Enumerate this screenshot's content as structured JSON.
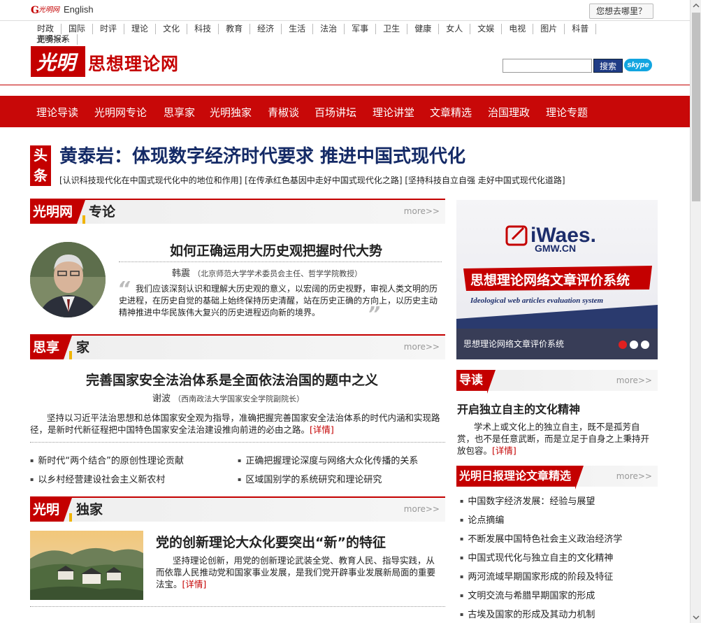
{
  "topbar": {
    "logo_text": "光明网",
    "english": "English",
    "where_button": "您想去哪里？"
  },
  "channels": [
    "时政",
    "国际",
    "时评",
    "理论",
    "文化",
    "科技",
    "教育",
    "经济",
    "生活",
    "法治",
    "军事",
    "卫生",
    "健康",
    "女人",
    "文娱",
    "电视",
    "图片",
    "科普",
    "光明报系"
  ],
  "channels_more": "更多>>",
  "brand": {
    "seal_text": "光明",
    "site_name": "思想理论网",
    "search_button": "搜索",
    "skype": "skype"
  },
  "main_nav": [
    "理论导读",
    "光明网专论",
    "思享家",
    "光明独家",
    "青椒谈",
    "百场讲坛",
    "理论讲堂",
    "文章精选",
    "治国理政",
    "理论专题"
  ],
  "headline": {
    "badge_1": "头",
    "badge_2": "条",
    "title": "黄泰岩：体现数字经济时代要求 推进中国式现代化",
    "sublinks": "[认识科技现代化在中国式现代化中的地位和作用] [在传承红色基因中走好中国式现代化之路] [坚持科技自立自强 走好中国式现代化道路]"
  },
  "sec_zhuanlun": {
    "tag": "光明网",
    "tag2": "专论",
    "more": "more>>",
    "title": "如何正确运用大历史观把握时代大势",
    "author": "韩震",
    "author_note": "（北京师范大学学术委员会主任、哲学学院教授）",
    "summary": "我们应该深刻认识和理解大历史观的意义，以宏阔的历史视野，审视人类文明的历史进程，在历史自觉的基础上始终保持历史清醒，站在历史正确的方向上，以历史主动精神推进中华民族伟大复兴的历史进程迈向新的境界。"
  },
  "sec_sixiangjia": {
    "tag": "思享",
    "tag2": "家",
    "more": "more>>",
    "title": "完善国家安全法治体系是全面依法治国的题中之义",
    "author": "谢波",
    "author_note": "（西南政法大学国家安全学院副院长）",
    "summary": "坚持以习近平法治思想和总体国家安全观为指导，准确把握完善国家安全法治体系的时代内涵和实现路径，是新时代新征程把中国特色国家安全法治建设推向前进的必由之路。",
    "detail": "[详情]",
    "links": [
      "新时代“两个结合”的原创性理论贡献",
      "正确把握理论深度与网络大众化传播的关系",
      "以乡村经营建设社会主义新农村",
      "区域国别学的系统研究和理论研究"
    ]
  },
  "sec_dujia": {
    "tag": "光明",
    "tag2": "独家",
    "more": "more>>",
    "title": "党的创新理论大众化要突出“新”的特征",
    "summary": "坚持理论创新，用党的创新理论武装全党、教育人民、指导实践，从而依靠人民推动党和国家事业发展，是我们党开辟事业发展新局面的重要法宝。",
    "detail": "[详情]"
  },
  "right": {
    "banner_logo": "iWaes.",
    "banner_domain": "GMW.CN",
    "banner_title": "思想理论网络文章评价系统",
    "banner_en": "Ideological web articles evaluation system",
    "banner_caption": "思想理论网络文章评价系统",
    "daodu_tag": "导读",
    "daodu_more": "more>>",
    "daodu_title": "开启独立自主的文化精神",
    "daodu_summary": "学术上或文化上的独立自主，既不是孤芳自赏，也不是任意武断，而是立足于自身之上秉持开放包容。",
    "daodu_detail": "[详情]",
    "jingxuan_tag": "光明日报理论文章精选",
    "jingxuan_more": "more>>",
    "jingxuan_items": [
      "中国数字经济发展：经验与展望",
      "论点摘编",
      "不断发展中国特色社会主义政治经济学",
      "中国式现代化与独立自主的文化精神",
      "两河流域早期国家形成的阶段及特征",
      "文明交流与希腊早期国家的形成",
      "古埃及国家的形成及其动力机制"
    ]
  },
  "colors": {
    "brand_red": "#c40000",
    "headline_navy": "#142a66",
    "search_blue": "#1f3c86"
  }
}
